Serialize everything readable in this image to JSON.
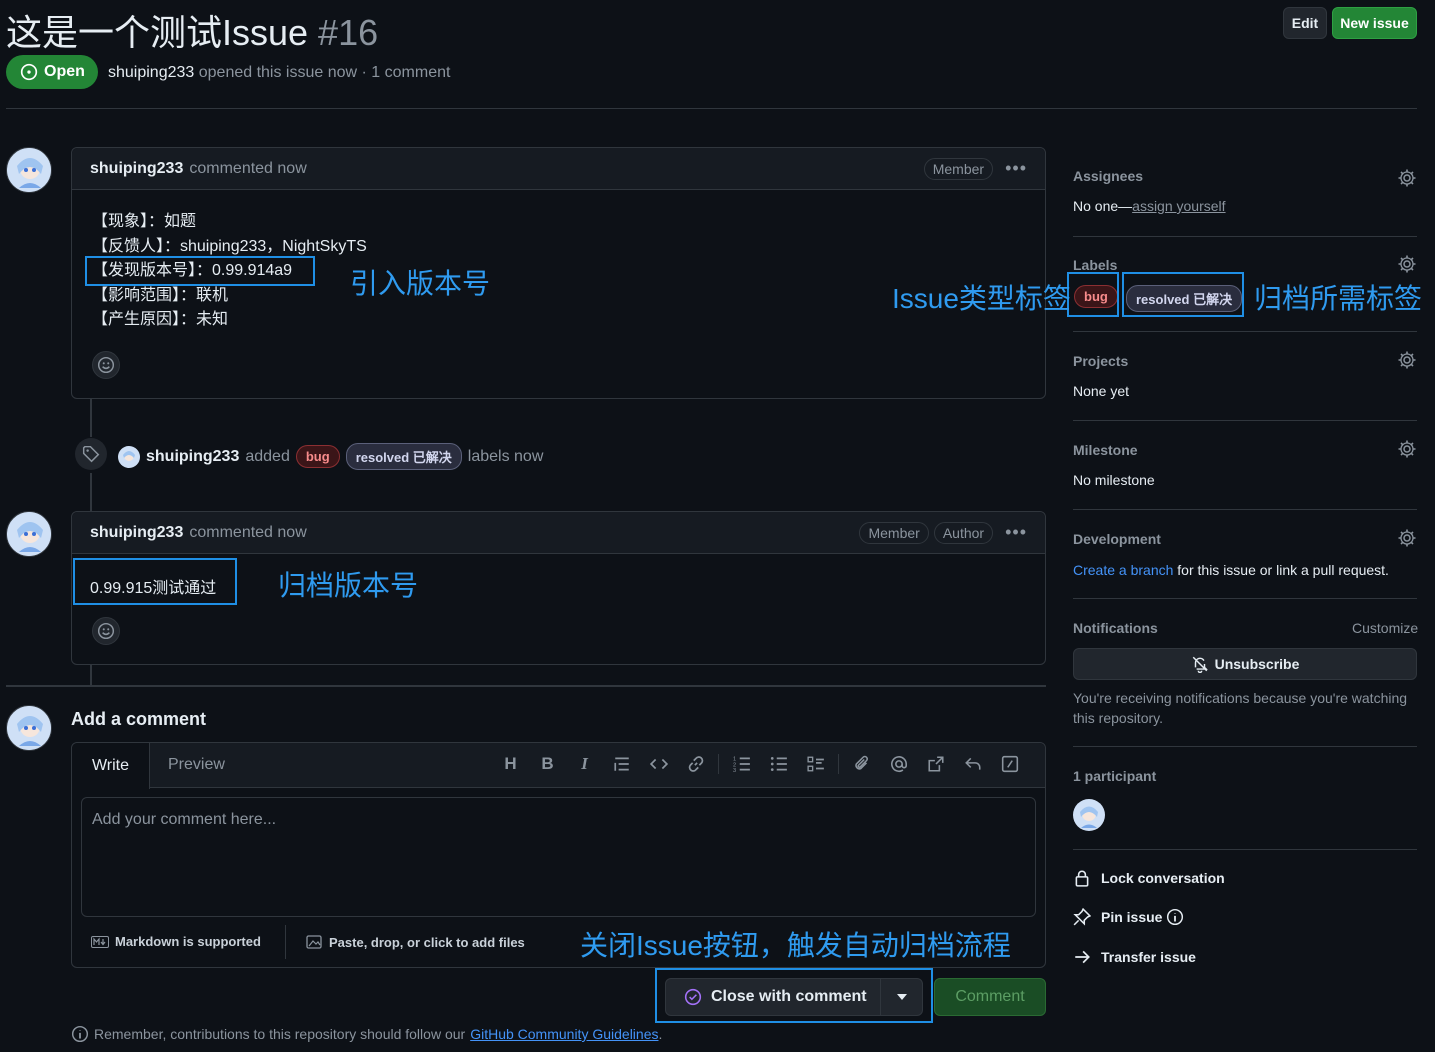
{
  "issue": {
    "title": "这是一个测试Issue",
    "number": "#16",
    "state": "Open",
    "author": "shuiping233",
    "meta_rest": "opened this issue now · 1 comment"
  },
  "header": {
    "edit_label": "Edit",
    "new_issue_label": "New issue"
  },
  "comment1": {
    "author": "shuiping233",
    "time": "commented now",
    "badge": "Member",
    "lines": [
      "【现象】：如题",
      "【反馈人】：shuiping233，NightSkyTS",
      "【发现版本号】：0.99.914a9",
      "【影响范围】：联机",
      "【产生原因】：未知"
    ]
  },
  "event": {
    "author": "shuiping233",
    "action": "added",
    "labels": [
      "bug",
      "resolved 已解决"
    ],
    "suffix": "labels now"
  },
  "comment2": {
    "author": "shuiping233",
    "time": "commented now",
    "badges": [
      "Member",
      "Author"
    ],
    "body": "0.99.915测试通过"
  },
  "annotations": {
    "version_intro": "引入版本号",
    "type_label": "Issue类型标签",
    "archive_label": "归档所需标签",
    "archive_version": "归档版本号",
    "close_hint": "关闭Issue按钮，触发自动归档流程"
  },
  "composer": {
    "heading": "Add a comment",
    "tab_write": "Write",
    "tab_preview": "Preview",
    "placeholder": "Add your comment here...",
    "markdown_note": "Markdown is supported",
    "files_note": "Paste, drop, or click to add files",
    "close_label": "Close with comment",
    "comment_label": "Comment",
    "footer_text": "Remember, contributions to this repository should follow our",
    "footer_link": "GitHub Community Guidelines",
    "footer_end": "."
  },
  "sidebar": {
    "assignees": {
      "heading": "Assignees",
      "text": "No one—",
      "link": "assign yourself"
    },
    "labels": {
      "heading": "Labels",
      "items": [
        "bug",
        "resolved 已解决"
      ]
    },
    "projects": {
      "heading": "Projects",
      "text": "None yet"
    },
    "milestone": {
      "heading": "Milestone",
      "text": "No milestone"
    },
    "development": {
      "heading": "Development",
      "link": "Create a branch",
      "text": "for this issue or link a pull request."
    },
    "notifications": {
      "heading": "Notifications",
      "customize": "Customize",
      "unsubscribe": "Unsubscribe",
      "note": "You're receiving notifications because you're watching this repository."
    },
    "participants": {
      "heading": "1 participant"
    },
    "actions": {
      "lock": "Lock conversation",
      "pin": "Pin issue",
      "transfer": "Transfer issue"
    }
  },
  "colors": {
    "accent": "#238636",
    "annotation": "#2f9bf0",
    "link": "#4493f8",
    "bg": "#0d1117"
  }
}
